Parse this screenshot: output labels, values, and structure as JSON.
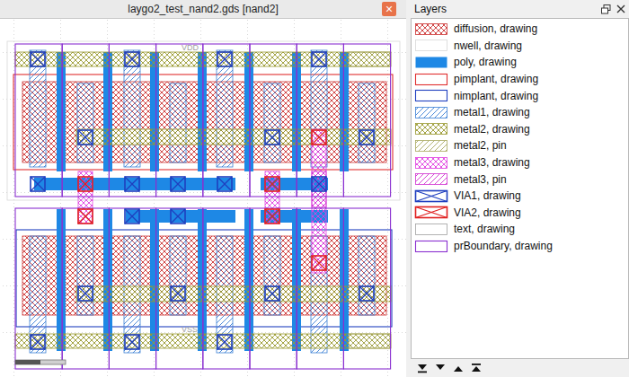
{
  "window": {
    "title": "laygo2_test_nand2.gds [nand2]",
    "close": "×"
  },
  "canvas": {
    "labels": [
      "VDD",
      "VSS"
    ]
  },
  "layers_panel": {
    "title": "Layers",
    "layers": [
      {
        "name": "diffusion, drawing",
        "color": "#cc3333",
        "kind": "cross"
      },
      {
        "name": "nwell, drawing",
        "color": "#d8d8d8",
        "kind": "empty"
      },
      {
        "name": "poly, drawing",
        "color": "#1e88e5",
        "kind": "solid"
      },
      {
        "name": "pimplant, drawing",
        "color": "#e03030",
        "kind": "outline"
      },
      {
        "name": "nimplant, drawing",
        "color": "#2040c0",
        "kind": "outline"
      },
      {
        "name": "metal1, drawing",
        "color": "#3a7fd5",
        "kind": "hatch"
      },
      {
        "name": "metal2, drawing",
        "color": "#9a9a30",
        "kind": "cross"
      },
      {
        "name": "metal2, pin",
        "color": "#a8a860",
        "kind": "hatch"
      },
      {
        "name": "metal3, drawing",
        "color": "#e040e0",
        "kind": "cross"
      },
      {
        "name": "metal3, pin",
        "color": "#d030d0",
        "kind": "hatch"
      },
      {
        "name": "VIA1, drawing",
        "color": "#1f3fbf",
        "kind": "via"
      },
      {
        "name": "VIA2, drawing",
        "color": "#e02020",
        "kind": "via"
      },
      {
        "name": "text, drawing",
        "color": "#a0a0a0",
        "kind": "empty"
      },
      {
        "name": "prBoundary, drawing",
        "color": "#8a30d0",
        "kind": "outline"
      }
    ]
  }
}
